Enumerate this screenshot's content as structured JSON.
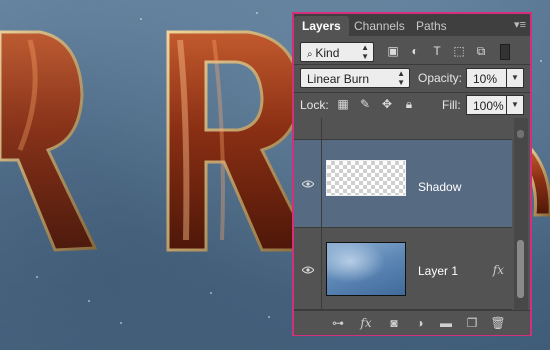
{
  "panel": {
    "tabs": [
      {
        "label": "Layers",
        "active": true
      },
      {
        "label": "Channels",
        "active": false
      },
      {
        "label": "Paths",
        "active": false
      }
    ],
    "filter_kind": "Kind",
    "blend_mode": "Linear Burn",
    "opacity_label": "Opacity:",
    "opacity_value": "10%",
    "lock_label": "Lock:",
    "fill_label": "Fill:",
    "fill_value": "100%",
    "layers": [
      {
        "name": "Shadow",
        "visible": true,
        "selected": true,
        "thumbnail": "transparent"
      },
      {
        "name": "Layer 1",
        "visible": true,
        "selected": false,
        "thumbnail": "photo",
        "fx": "fx"
      }
    ],
    "footer_fx": "fx"
  },
  "colors": {
    "panel_border": "#d2307d",
    "panel_bg": "#535353",
    "selected_row": "#566a82"
  }
}
